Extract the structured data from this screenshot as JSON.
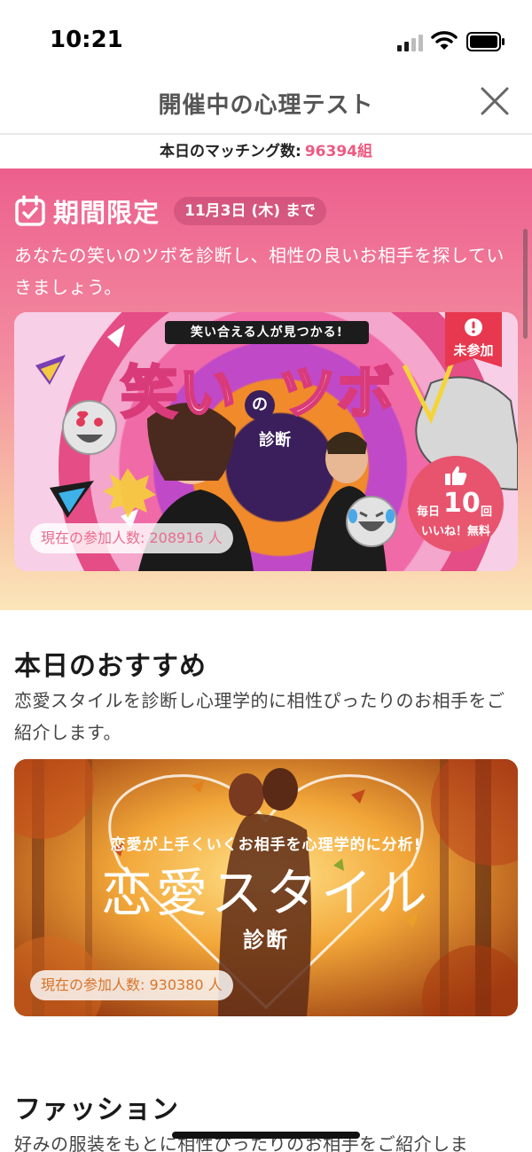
{
  "status_bar": {
    "time": "10:21"
  },
  "header": {
    "title": "開催中の心理テスト"
  },
  "matching": {
    "label": "本日のマッチング数:",
    "count": "96394組"
  },
  "limited": {
    "title": "期間限定",
    "deadline": "11月3日 (木) まで",
    "description": "あなたの笑いのツボを診断し、相性の良いお相手を探していきましょう。",
    "card": {
      "tagline": "笑い合える人が見つかる!",
      "title_part1": "笑い",
      "title_no": "の",
      "title_part2": "ツボ",
      "subtitle": "診断",
      "status_badge": "未参加",
      "like_daily": "毎日",
      "like_count": "10",
      "like_unit": "回",
      "like_free": "いいね！無料",
      "participants": "現在の参加人数: 208916 人"
    }
  },
  "recommend": {
    "title": "本日のおすすめ",
    "description": "恋愛スタイルを診断し心理学的に相性ぴったりのお相手をご紹介します。",
    "card": {
      "tagline": "恋愛が上手くいくお相手を心理学的に分析!",
      "title": "恋愛スタイル",
      "subtitle": "診断",
      "participants": "現在の参加人数: 930380 人"
    }
  },
  "fashion": {
    "title": "ファッション",
    "description": "好みの服装をもとに相性ぴったりのお相手をご紹介しま"
  },
  "colors": {
    "accent_pink": "#ec5a82",
    "gradient_top": "#ed5f8e",
    "gradient_bottom": "#fbe6b9",
    "badge_red": "#e8384f"
  },
  "icons": [
    "signal-icon",
    "wifi-icon",
    "battery-icon",
    "close-icon",
    "calendar-check-icon",
    "alert-icon",
    "thumbs-up-icon"
  ]
}
